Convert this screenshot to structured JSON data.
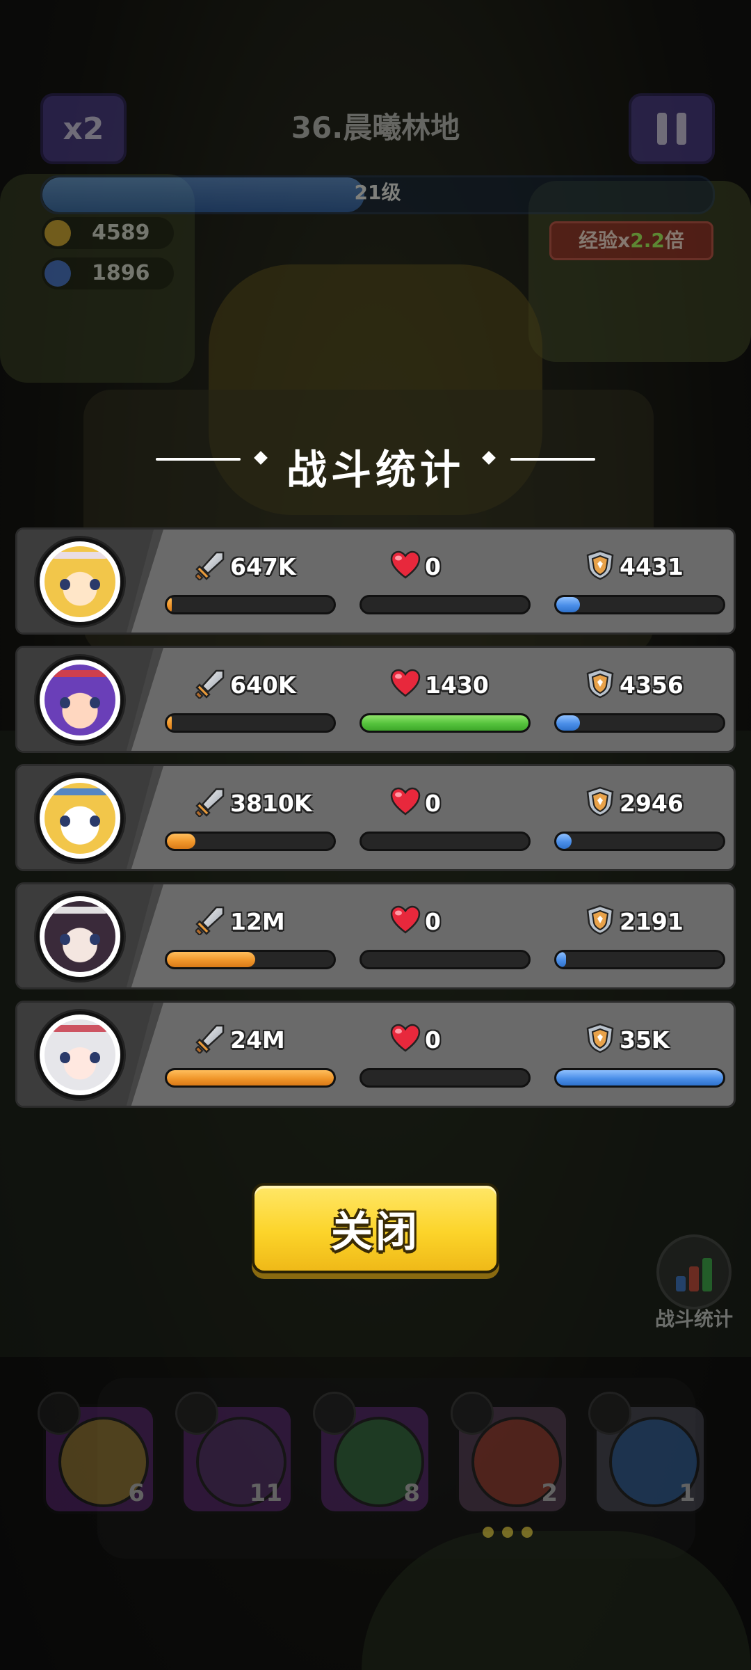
{
  "hud": {
    "speed_label": "x2",
    "level_title": "36.晨曦林地",
    "xp_level": "21级",
    "gold": "4589",
    "gems": "1896",
    "exp_badge_prefix": "经验x",
    "exp_badge_mult": "2.2",
    "exp_badge_suffix": "倍"
  },
  "panel": {
    "title": "战斗统计",
    "close_label": "关闭"
  },
  "heroes": [
    {
      "damage": "647K",
      "heal": "0",
      "tank": "4431",
      "damage_pct": 3,
      "heal_pct": 0,
      "tank_pct": 14
    },
    {
      "damage": "640K",
      "heal": "1430",
      "tank": "4356",
      "damage_pct": 3,
      "heal_pct": 100,
      "tank_pct": 14
    },
    {
      "damage": "3810K",
      "heal": "0",
      "tank": "2946",
      "damage_pct": 17,
      "heal_pct": 0,
      "tank_pct": 9
    },
    {
      "damage": "12M",
      "heal": "0",
      "tank": "2191",
      "damage_pct": 53,
      "heal_pct": 0,
      "tank_pct": 6
    },
    {
      "damage": "24M",
      "heal": "0",
      "tank": "35K",
      "damage_pct": 100,
      "heal_pct": 0,
      "tank_pct": 100
    }
  ],
  "side_button": {
    "label": "战斗统计"
  },
  "skills": [
    {
      "count": "6",
      "color": "#6a2a8a"
    },
    {
      "count": "11",
      "color": "#6a2a8a"
    },
    {
      "count": "8",
      "color": "#6a2a8a"
    },
    {
      "count": "2",
      "color": "#6a4a6a"
    },
    {
      "count": "1",
      "color": "#5a5a6a"
    }
  ],
  "colors": {
    "damage_bar": "#f0962a",
    "heal_bar": "#54c23c",
    "tank_bar": "#4a8ee8",
    "close_button": "#fcd42a"
  }
}
